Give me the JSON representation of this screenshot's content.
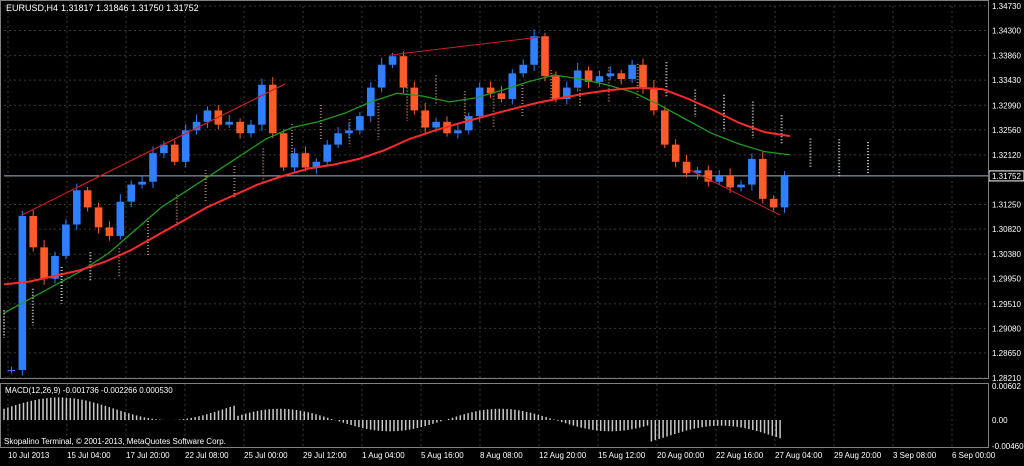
{
  "header": {
    "symbol": "EURUSD,H4",
    "ohlc": "1.31817 1.31846 1.31750 1.31752"
  },
  "macd_header": "MACD(12,26,9) -0.001736 -0.002266 0.000530",
  "footer": "Skopalino Terminal, © 2001-2013, MetaQuotes Software Corp.",
  "colors": {
    "background": "#000000",
    "grid": "#3a3a3a",
    "axis": "#c0c0c0",
    "bull": "#2f7fff",
    "bear": "#ff5a2a",
    "ma_fast": "#ff2a2a",
    "ma_slow": "#1f9a1f",
    "cloud": "#c88c60",
    "cloud_light": "#f0f0f0",
    "trendline": "#cc2020",
    "price_line": "#9fb8c8"
  },
  "chart_data": [
    {
      "type": "line",
      "title": "EURUSD,H4",
      "subtitle": "1.31817 1.31846 1.31750 1.31752",
      "y_ticks": [
        "1.34730",
        "1.34300",
        "1.33860",
        "1.33430",
        "1.32990",
        "1.32560",
        "1.32120",
        "1.31752",
        "1.31250",
        "1.30820",
        "1.30380",
        "1.29950",
        "1.29510",
        "1.29080",
        "1.28650",
        "1.28210"
      ],
      "ylim": [
        1.2821,
        1.3473
      ],
      "current_price": "1.31752",
      "x_ticks": [
        "10 Jul 2013",
        "15 Jul 04:00",
        "17 Jul 20:00",
        "22 Jul 08:00",
        "25 Jul 00:00",
        "29 Jul 12:00",
        "1 Aug 04:00",
        "5 Aug 16:00",
        "8 Aug 08:00",
        "12 Aug 20:00",
        "15 Aug 12:00",
        "20 Aug 00:00",
        "22 Aug 16:00",
        "27 Aug 04:00",
        "29 Aug 20:00",
        "3 Sep 08:00",
        "6 Sep 00:00"
      ],
      "close_path": [
        1.2835,
        1.3105,
        1.305,
        1.2995,
        1.3035,
        1.309,
        1.315,
        1.312,
        1.3085,
        1.307,
        1.313,
        1.316,
        1.3165,
        1.3215,
        1.323,
        1.32,
        1.3255,
        1.327,
        1.329,
        1.3265,
        1.327,
        1.325,
        1.3265,
        1.3335,
        1.325,
        1.319,
        1.3215,
        1.319,
        1.32,
        1.323,
        1.325,
        1.3255,
        1.328,
        1.333,
        1.337,
        1.3385,
        1.333,
        1.329,
        1.326,
        1.327,
        1.325,
        1.3255,
        1.328,
        1.333,
        1.332,
        1.331,
        1.3355,
        1.337,
        1.342,
        1.335,
        1.331,
        1.333,
        1.336,
        1.334,
        1.335,
        1.3355,
        1.3345,
        1.337,
        1.333,
        1.329,
        1.323,
        1.32,
        1.318,
        1.3185,
        1.3165,
        1.3175,
        1.3155,
        1.316,
        1.3205,
        1.3135,
        1.312,
        1.3175
      ],
      "ma_red": [
        1.2985,
        1.299,
        1.3,
        1.301,
        1.3025,
        1.3045,
        1.307,
        1.3095,
        1.312,
        1.314,
        1.316,
        1.3175,
        1.3188,
        1.3195,
        1.3205,
        1.322,
        1.324,
        1.3255,
        1.3268,
        1.328,
        1.3292,
        1.3303,
        1.3312,
        1.332,
        1.3326,
        1.333,
        1.3327,
        1.331,
        1.329,
        1.3268,
        1.3252,
        1.3245
      ],
      "ma_green": [
        1.2935,
        1.296,
        1.2985,
        1.301,
        1.304,
        1.308,
        1.312,
        1.315,
        1.318,
        1.321,
        1.324,
        1.326,
        1.327,
        1.3285,
        1.3305,
        1.332,
        1.3315,
        1.3305,
        1.3312,
        1.3325,
        1.334,
        1.3352,
        1.3345,
        1.3335,
        1.3322,
        1.33,
        1.3275,
        1.325,
        1.3232,
        1.3218,
        1.3212
      ]
    },
    {
      "type": "bar",
      "title": "MACD(12,26,9)",
      "values_text": "-0.001736 -0.002266 0.000530",
      "y_ticks": [
        "0.00602",
        "0.00",
        "-0.00460"
      ],
      "ylim": [
        -0.0046,
        0.00602
      ]
    }
  ]
}
